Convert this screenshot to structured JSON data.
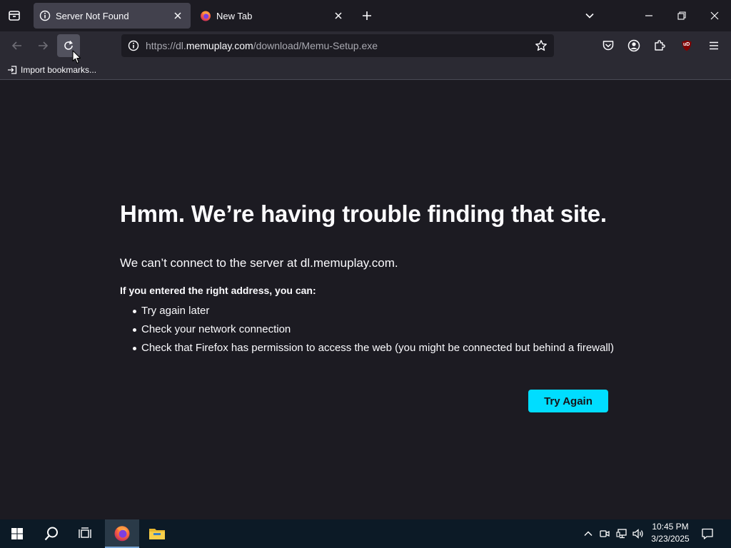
{
  "colors": {
    "accent": "#00ddff",
    "page_bg": "#1c1b22",
    "toolbar_bg": "#2b2a33",
    "active_tab_bg": "#42414d",
    "taskbar_bg": "#0c1a26"
  },
  "tabs": [
    {
      "title": "Server Not Found",
      "icon": "info-icon",
      "active": true
    },
    {
      "title": "New Tab",
      "icon": "firefox-icon",
      "active": false
    }
  ],
  "urlbar": {
    "prefix": "https://dl.",
    "host": "memuplay.com",
    "path": "/download/Memu-Setup.exe"
  },
  "bookmarks": {
    "import_label": "Import bookmarks..."
  },
  "error": {
    "title": "Hmm. We’re having trouble finding that site.",
    "description": "We can’t connect to the server at dl.memuplay.com.",
    "subtitle": "If you entered the right address, you can:",
    "suggestions": [
      "Try again later",
      "Check your network connection",
      "Check that Firefox has permission to access the web (you might be connected but behind a firewall)"
    ],
    "button_label": "Try Again"
  },
  "taskbar": {
    "time": "10:45 PM",
    "date": "3/23/2025"
  },
  "extension": {
    "ublock_badge": "uD"
  }
}
